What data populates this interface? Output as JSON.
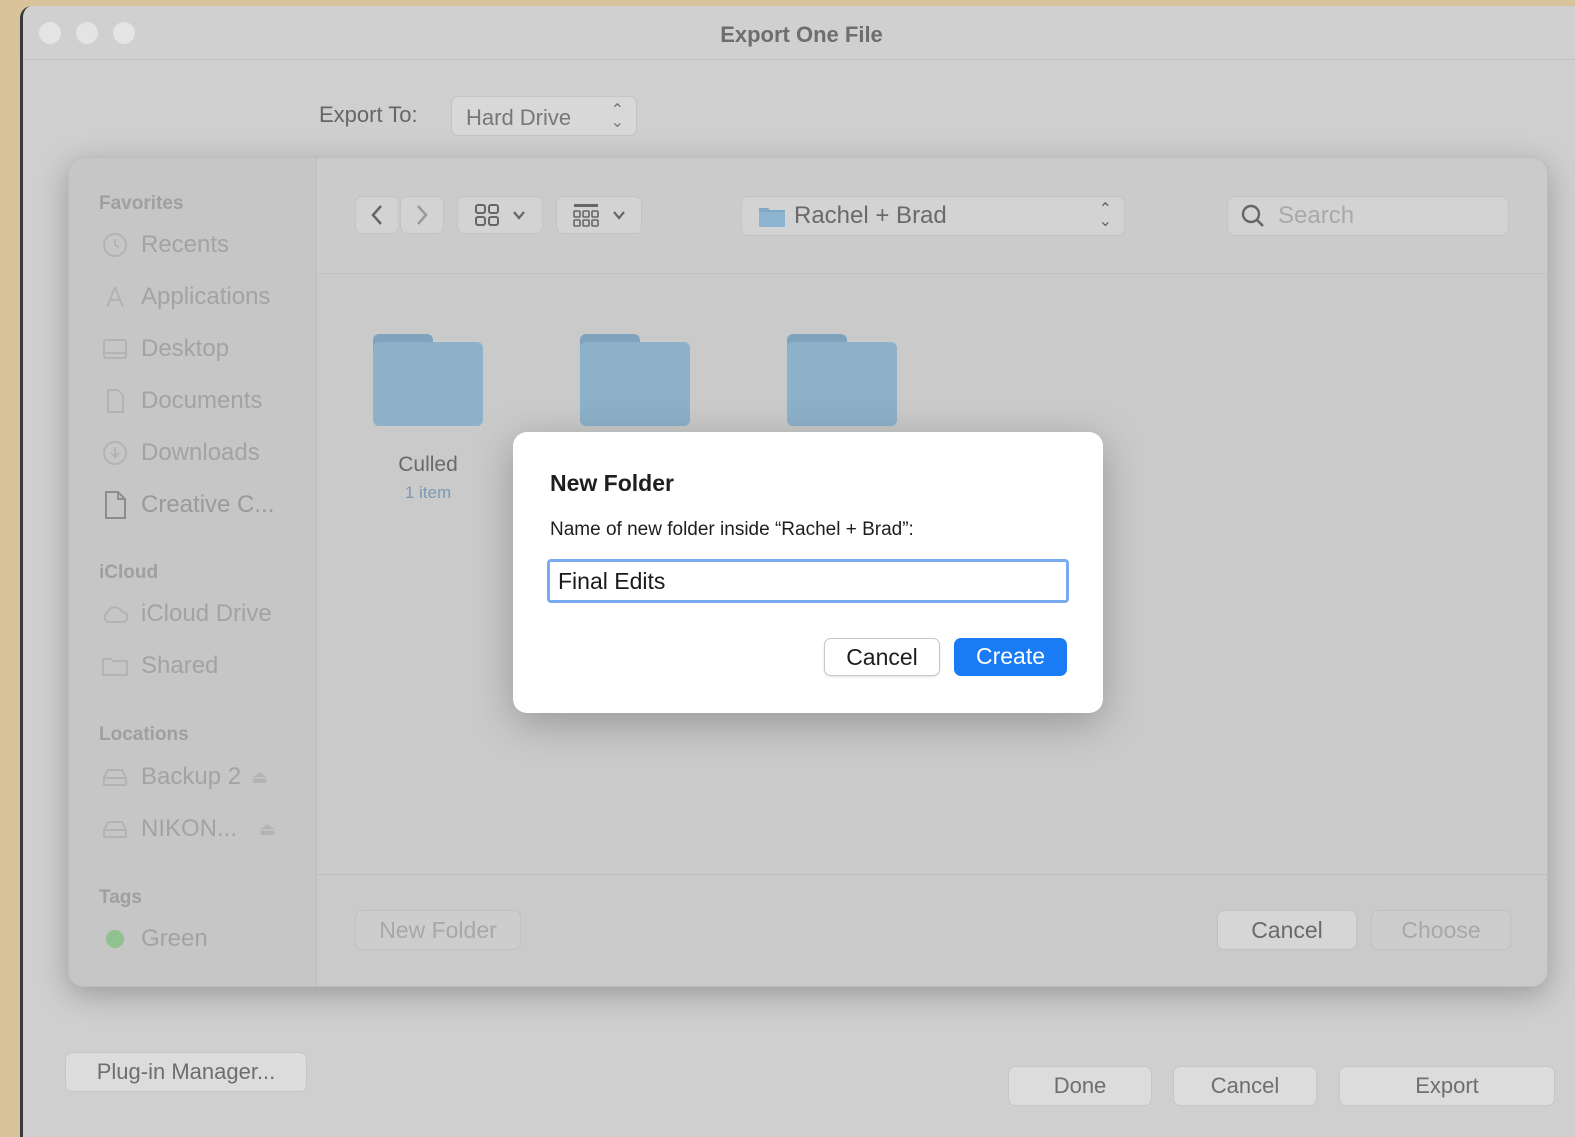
{
  "window": {
    "title": "Export One File",
    "export_to_label": "Export To:",
    "export_to_value": "Hard Drive",
    "plugin_manager": "Plug-in Manager...",
    "done": "Done",
    "cancel": "Cancel",
    "export": "Export"
  },
  "sidebar": {
    "favorites_header": "Favorites",
    "favorites": [
      {
        "label": "Recents",
        "icon": "clock-icon"
      },
      {
        "label": "Applications",
        "icon": "applications-icon"
      },
      {
        "label": "Desktop",
        "icon": "desktop-icon"
      },
      {
        "label": "Documents",
        "icon": "document-icon"
      },
      {
        "label": "Downloads",
        "icon": "download-icon"
      },
      {
        "label": "Creative C...",
        "icon": "file-icon"
      }
    ],
    "icloud_header": "iCloud",
    "icloud": [
      {
        "label": "iCloud Drive",
        "icon": "cloud-icon"
      },
      {
        "label": "Shared",
        "icon": "shared-folder-icon"
      }
    ],
    "locations_header": "Locations",
    "locations": [
      {
        "label": "Backup 2",
        "icon": "drive-icon"
      },
      {
        "label": "NIKON...",
        "icon": "drive-icon"
      }
    ],
    "tags_header": "Tags",
    "tags": [
      {
        "label": "Green",
        "color": "#8fc28f"
      }
    ]
  },
  "browser": {
    "current_folder": "Rachel + Brad",
    "search_placeholder": "Search",
    "folders": [
      {
        "name": "Culled",
        "subtitle": "1 item"
      }
    ],
    "new_folder_button": "New Folder",
    "cancel_button": "Cancel",
    "choose_button": "Choose"
  },
  "dialog": {
    "title": "New Folder",
    "label": "Name of new folder inside “Rachel + Brad”:",
    "input_value": "Final Edits",
    "cancel": "Cancel",
    "create": "Create",
    "accent": "#1a7cf5"
  }
}
